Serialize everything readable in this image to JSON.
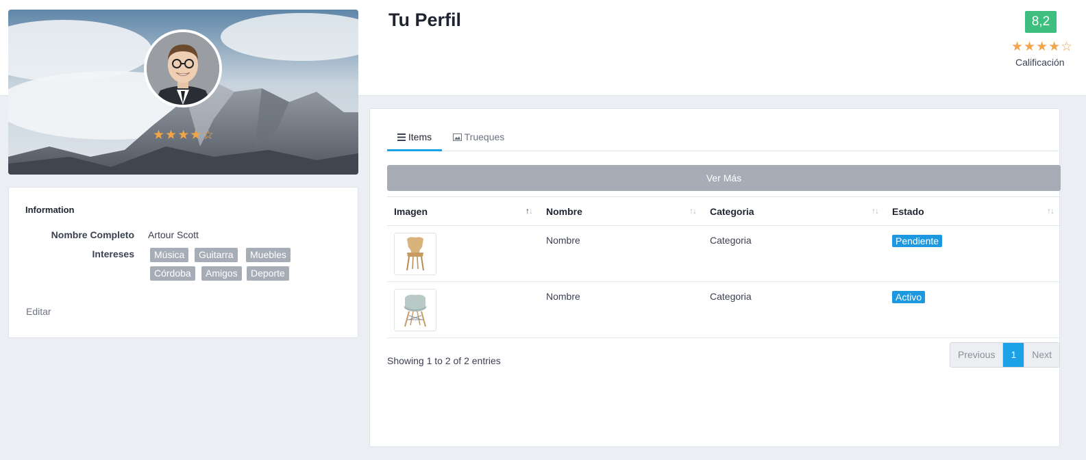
{
  "header": {
    "title": "Tu Perfil",
    "score": "8,2",
    "score_stars": "★★★★☆",
    "score_label": "Calificación"
  },
  "cover": {
    "stars": "★★★★☆"
  },
  "info": {
    "title": "Information",
    "fields": [
      {
        "label": "Nombre Completo",
        "value": "Artour Scott"
      },
      {
        "label": "Intereses"
      }
    ],
    "tags": [
      "Música",
      "Guitarra",
      "Muebles",
      "Córdoba",
      "Amigos",
      "Deporte"
    ],
    "edit_label": "Editar"
  },
  "main": {
    "tabs": [
      {
        "label": "Items",
        "icon": "list-icon",
        "active": true
      },
      {
        "label": "Trueques",
        "icon": "image-icon",
        "active": false
      }
    ],
    "ver_mas_label": "Ver Más",
    "table": {
      "columns": [
        "Imagen",
        "Nombre",
        "Categoria",
        "Estado"
      ],
      "rows": [
        {
          "nombre": "Nombre",
          "categoria": "Categoria",
          "estado": "Pendiente",
          "estado_color": "#1b98e0",
          "image": "wooden-chair"
        },
        {
          "nombre": "Nombre",
          "categoria": "Categoria",
          "estado": "Activo",
          "estado_color": "#1b98e0",
          "image": "shell-chair"
        }
      ]
    },
    "entries_text": "Showing 1 to 2 of 2 entries",
    "pagination": {
      "previous": "Previous",
      "current": "1",
      "next": "Next"
    }
  },
  "colors": {
    "accent": "#1aa1e6",
    "score_green": "#3fbf7f",
    "star": "#f2a54a",
    "tag_gray": "#a6adb7"
  }
}
